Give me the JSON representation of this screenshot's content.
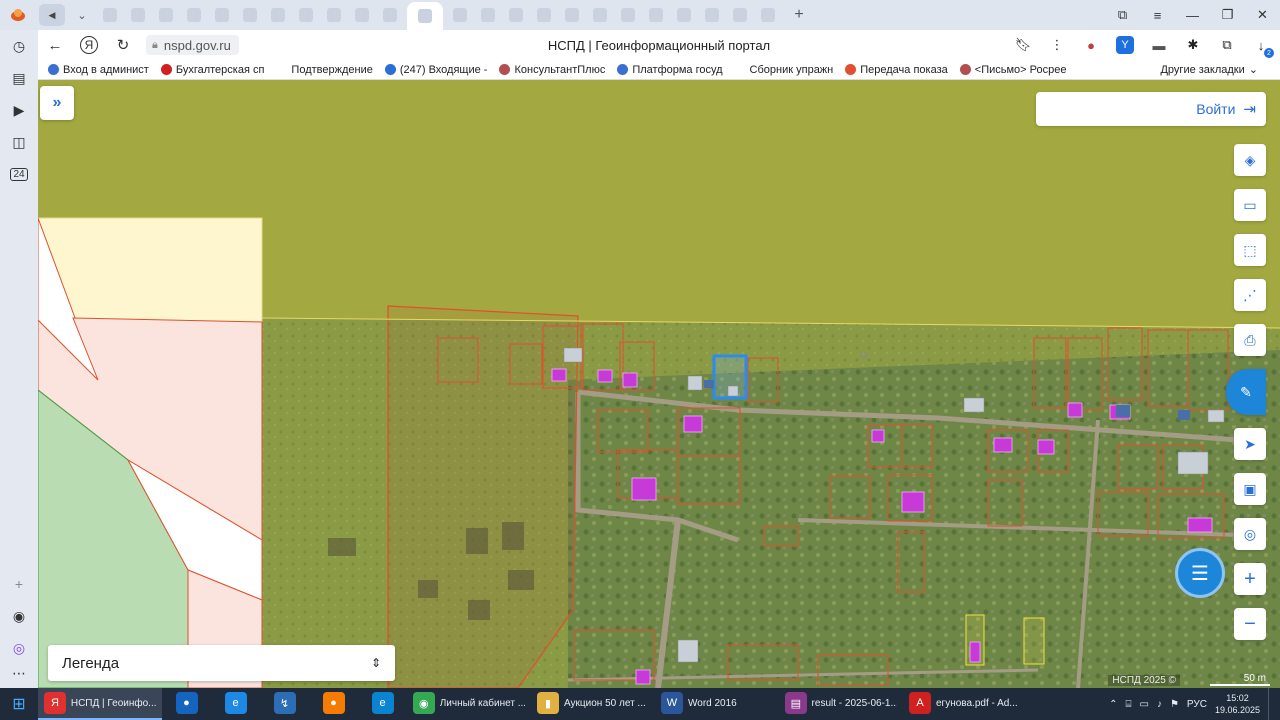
{
  "browser": {
    "tab_count": 24,
    "url": "nspd.gov.ru",
    "page_title": "НСПД | Геоинформационный портал",
    "bookmarks": [
      {
        "label": "Вход в админист",
        "color": "#3b6fd0"
      },
      {
        "label": "Бухгалтерская сп",
        "color": "#d02020"
      },
      {
        "label": "Подтверждение ",
        "color": "#ffffff"
      },
      {
        "label": "(247) Входящие -",
        "color": "#2a6fd6"
      },
      {
        "label": "КонсультантПлюс",
        "color": "#b05050"
      },
      {
        "label": "Платформа госуд",
        "color": "#3b6fd0"
      },
      {
        "label": "Сборник упражн",
        "color": "#ffffff"
      },
      {
        "label": "Передача показа",
        "color": "#e05030"
      },
      {
        "label": "<Письмо> Росрее",
        "color": "#b05050"
      }
    ],
    "other_bookmarks": "Другие закладки",
    "download_badge": "2"
  },
  "map": {
    "login_label": "Войти",
    "legend_label": "Легенда",
    "copyright": "НСПД 2025 ©",
    "scale": "50 m"
  },
  "taskbar": {
    "items": [
      {
        "label": "НСПД | Геоинфо...",
        "active": true,
        "color": "#e03030",
        "glyph": "Я"
      },
      {
        "label": "",
        "color": "#1565c0",
        "glyph": "●"
      },
      {
        "label": "",
        "color": "#1e88e5",
        "glyph": "e"
      },
      {
        "label": "",
        "color": "#2d6db5",
        "glyph": "↯"
      },
      {
        "label": "",
        "color": "#f57c00",
        "glyph": "●"
      },
      {
        "label": "",
        "color": "#0a84d0",
        "glyph": "e"
      },
      {
        "label": "Личный кабинет ...",
        "color": "#34a853",
        "glyph": "◉"
      },
      {
        "label": "Аукцион 50 лет ...",
        "color": "#e0b040",
        "glyph": "▮"
      },
      {
        "label": "Word 2016",
        "color": "#2b579a",
        "glyph": "W"
      },
      {
        "label": "result - 2025-06-1...",
        "color": "#8b3a8b",
        "glyph": "▤"
      },
      {
        "label": "егунова.pdf - Ad...",
        "color": "#d02020",
        "glyph": "A"
      }
    ],
    "language": "РУС",
    "time": "15:02",
    "date": "19.06.2025"
  }
}
